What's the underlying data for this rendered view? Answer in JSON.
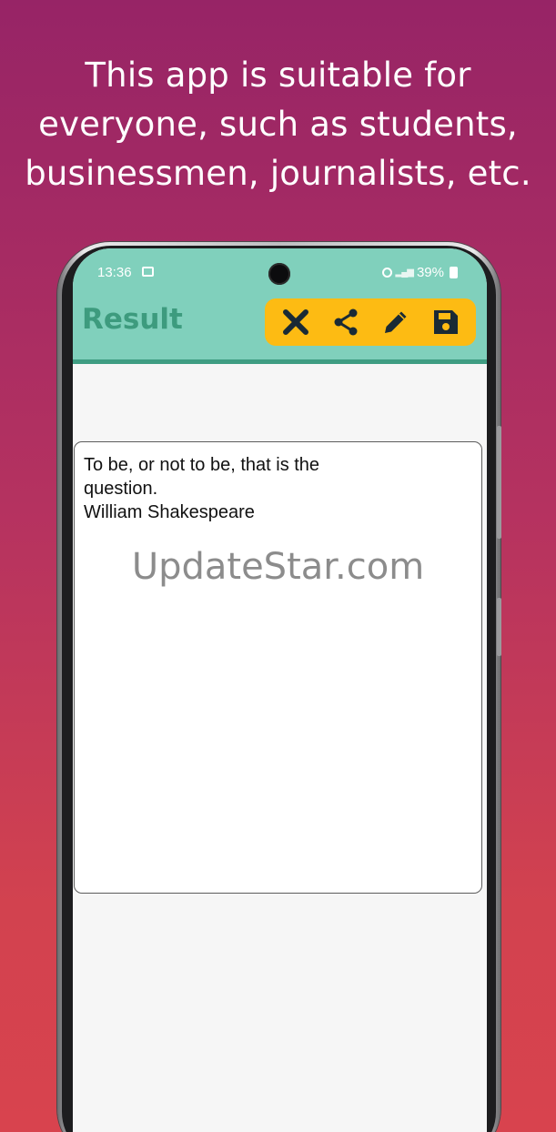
{
  "headline": {
    "line1": "This app is suitable for",
    "line2": "everyone, such as students,",
    "line3": "businessmen, journalists, etc."
  },
  "status_bar": {
    "time": "13:36",
    "battery": "39%"
  },
  "app_bar": {
    "title": "Result",
    "actions": [
      {
        "icon": "close-icon"
      },
      {
        "icon": "share-icon"
      },
      {
        "icon": "edit-icon"
      },
      {
        "icon": "save-icon"
      }
    ]
  },
  "result": {
    "line1": "To be, or not to be, that is the",
    "line2": "question.",
    "line3": "William Shakespeare"
  },
  "watermark": "UpdateStar.com",
  "colors": {
    "app_bar": "#80d0bc",
    "title": "#3d9b7e",
    "toolbar": "#fdbb13",
    "icons": "#1a2a35"
  }
}
